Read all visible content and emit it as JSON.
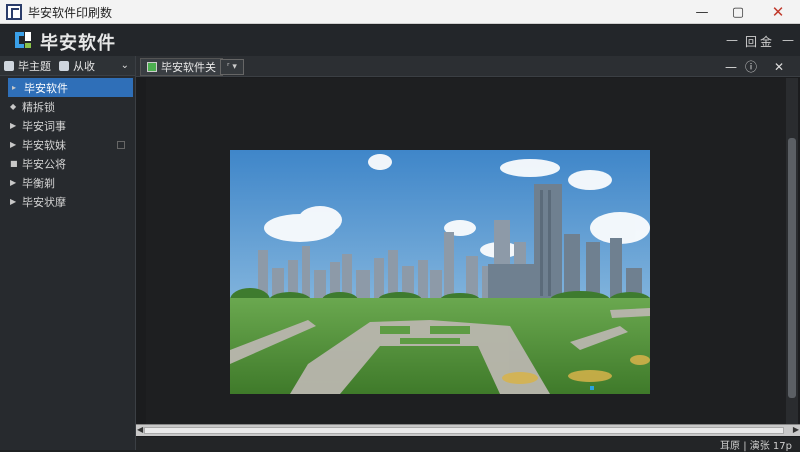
{
  "titlebar": {
    "title": "毕安软件印刷数",
    "min_label": "—",
    "max_label": "▢",
    "close_label": "✕"
  },
  "header": {
    "brand": "毕安软件",
    "controls": [
      "—",
      "回",
      "金",
      "—"
    ]
  },
  "sidebar": {
    "tabs": [
      {
        "label": "毕主题"
      },
      {
        "label": "从收"
      }
    ],
    "chevron": "⌄",
    "items": [
      {
        "label": "毕安软件",
        "selected": true,
        "icon": "chevron-right-icon"
      },
      {
        "label": "精拆锁",
        "icon": "diamond-icon"
      },
      {
        "label": "毕安词事",
        "icon": "triangle-right-icon"
      },
      {
        "label": "毕安软妹",
        "icon": "triangle-right-icon"
      },
      {
        "label": "毕安公将",
        "icon": "square-icon"
      },
      {
        "label": "毕衡剃",
        "icon": "triangle-right-icon"
      },
      {
        "label": "毕安状摩",
        "icon": "triangle-right-icon"
      }
    ]
  },
  "main": {
    "doc_tab": "毕安软件关",
    "tab_dropdown": "ʳ ▾",
    "panel_buttons": [
      "—",
      "ⓘ",
      "✕"
    ],
    "image_alt": "city-park-render",
    "status": "耳原 | 演张    17p"
  },
  "colors": {
    "accent": "#2f6fb8",
    "background": "#1b1c1e",
    "sidebar": "#272a2e"
  }
}
